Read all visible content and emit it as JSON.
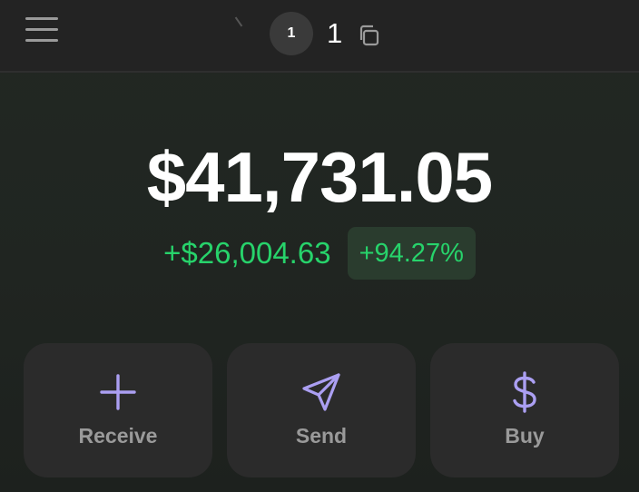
{
  "header": {
    "account_initial": "1",
    "account_name": "1"
  },
  "balance": {
    "total": "$41,731.05",
    "change_value": "+$26,004.63",
    "change_percent": "+94.27%"
  },
  "actions": {
    "receive_label": "Receive",
    "send_label": "Send",
    "buy_label": "Buy"
  },
  "colors": {
    "accent": "#ab9ff2",
    "positive": "#27d36b",
    "background": "#222823",
    "header": "#232323",
    "card": "#2b2b2b"
  },
  "icons": {
    "menu": "hamburger-icon",
    "copy": "copy-icon",
    "receive": "plus-icon",
    "send": "paper-plane-icon",
    "buy": "dollar-icon"
  }
}
